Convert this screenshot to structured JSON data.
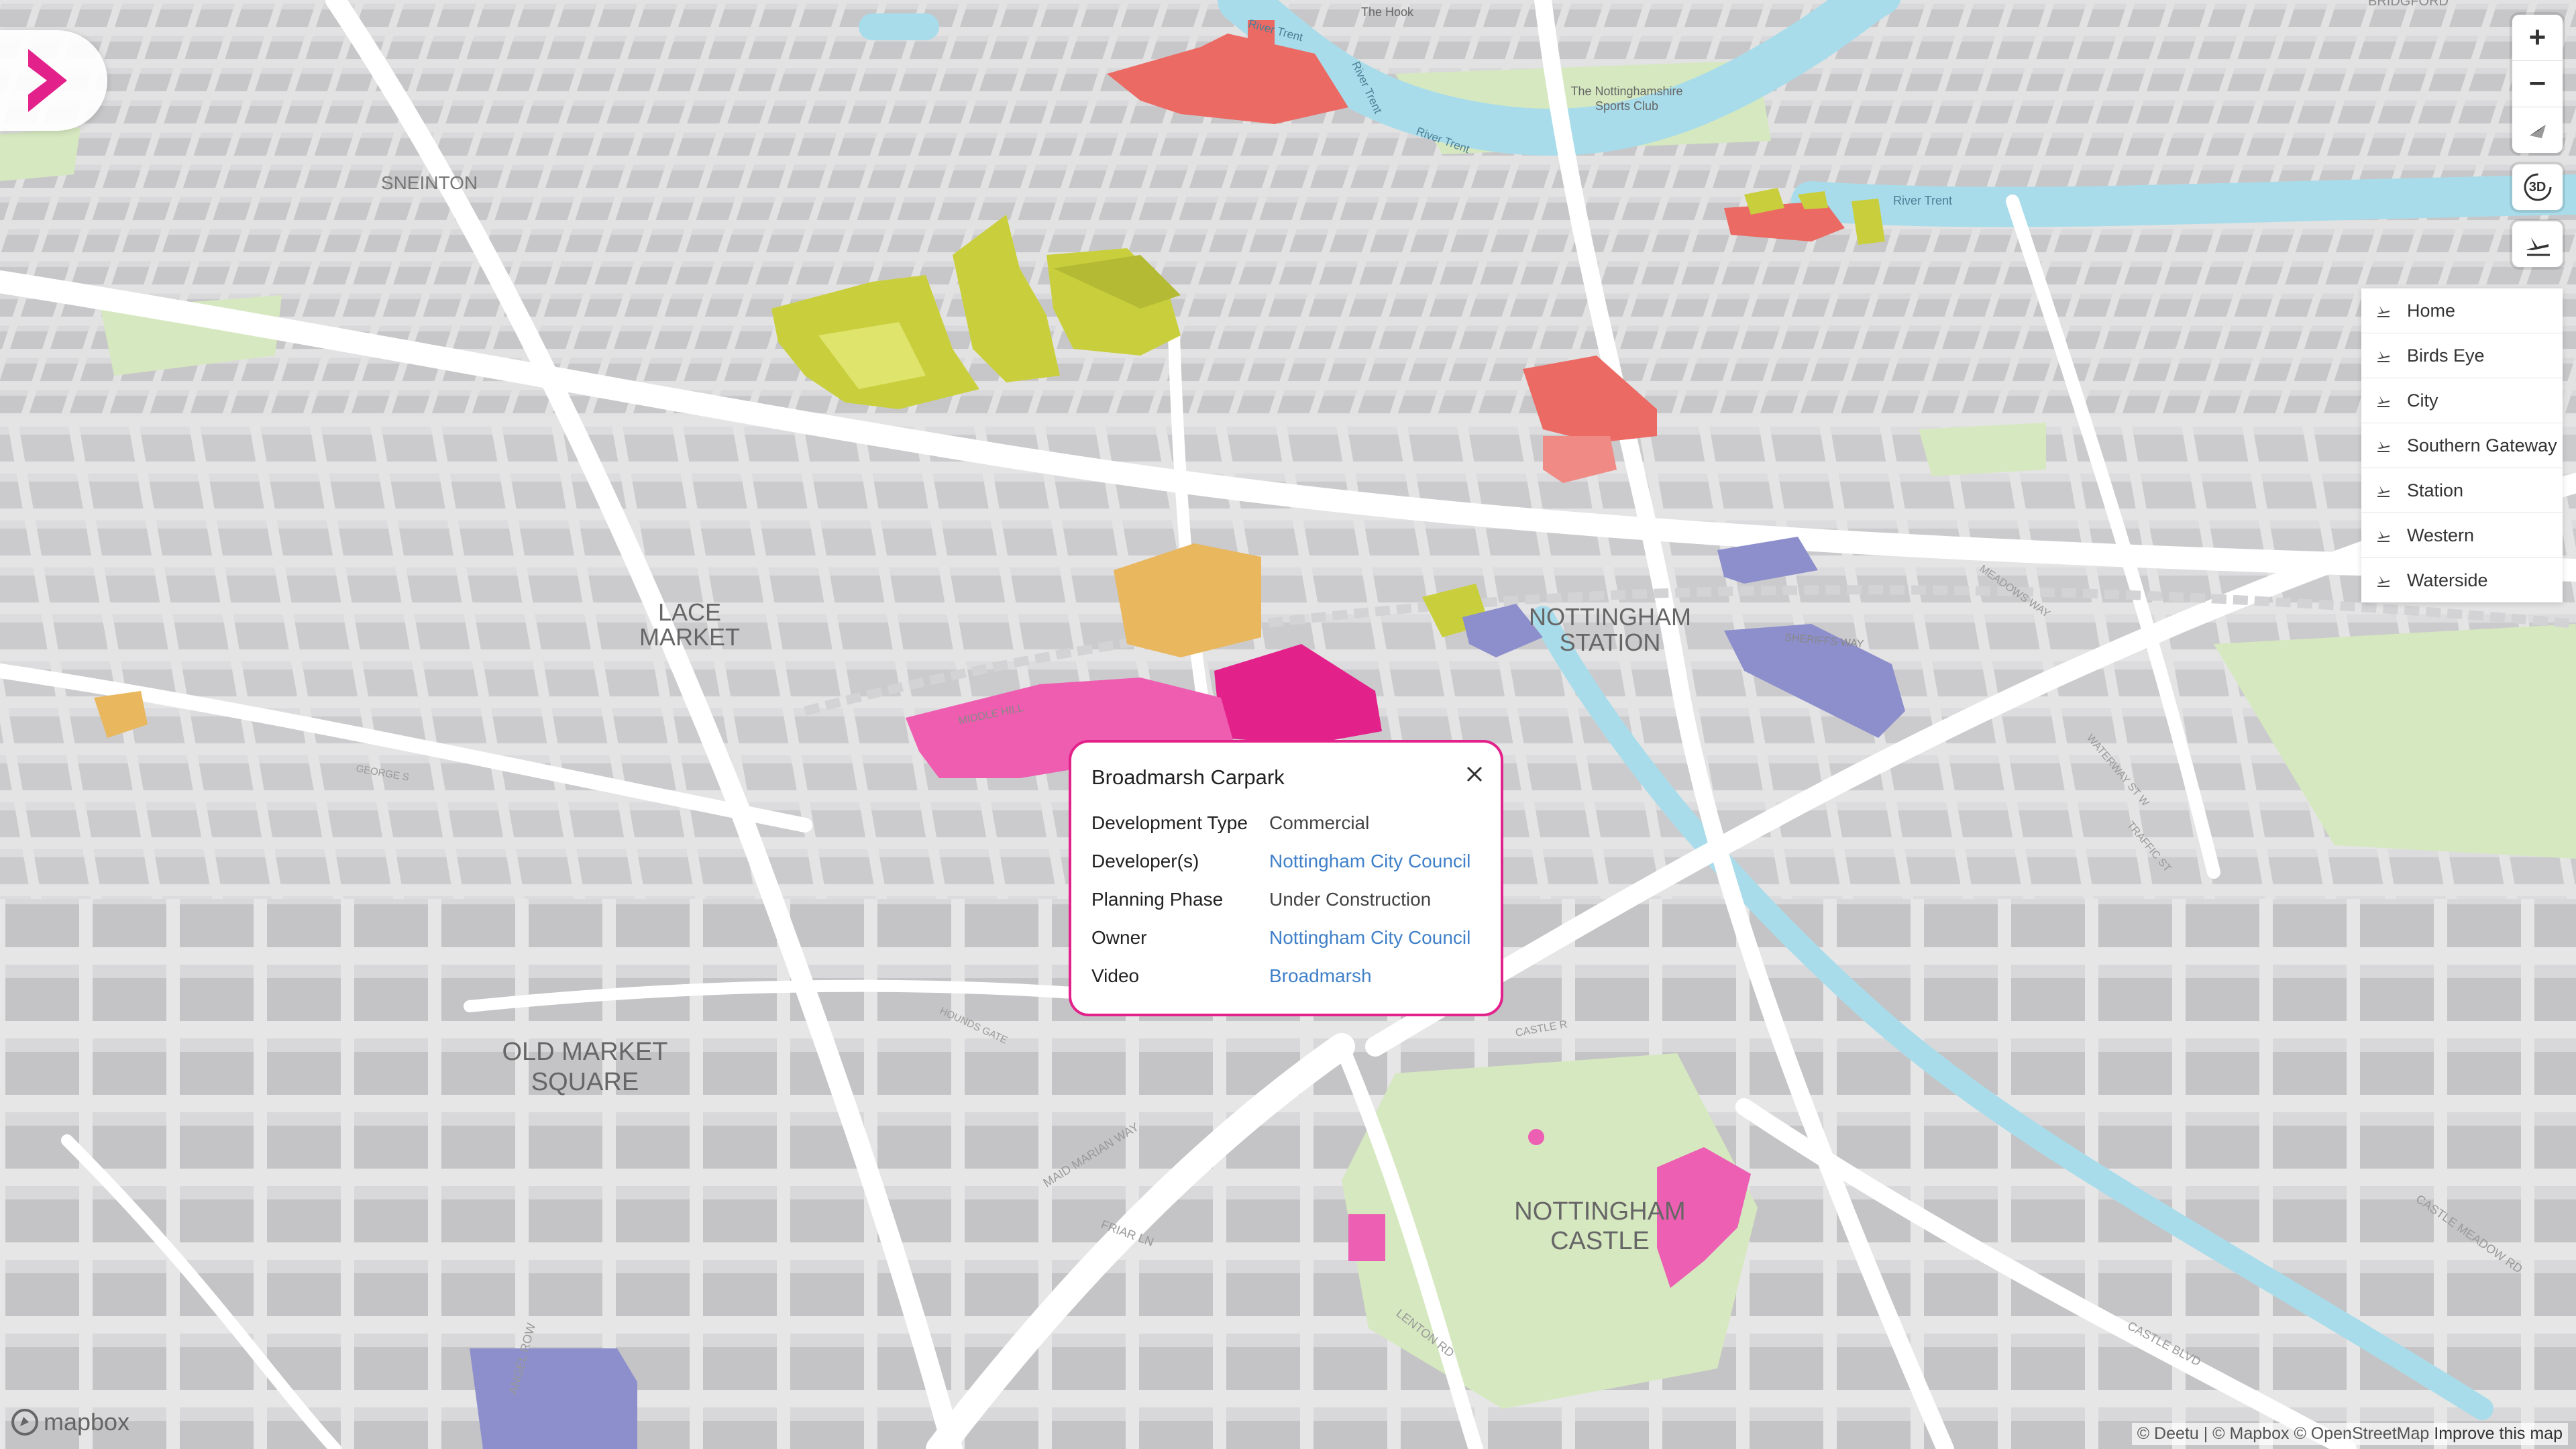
{
  "map": {
    "district_labels": [
      "SNEINTON",
      "LACE",
      "MARKET",
      "NOTTINGHAM",
      "STATION",
      "OLD MARKET",
      "SQUARE",
      "NOTTINGHAM",
      "CASTLE"
    ],
    "place_labels": [
      "The Hook",
      "The Nottinghamshire",
      "Sports Club",
      "River Trent",
      "River Trent",
      "River Trent",
      "River Trent",
      "BRIDGFORD"
    ],
    "street_labels": [
      "MIDDLE HILL",
      "SHERIFFS WAY",
      "MAID MARIAN WAY",
      "FRIAR LN",
      "LENTON RD",
      "CASTLE BLVD",
      "CASTLE MEADOW RD",
      "WATERWAY ST W",
      "TRAFFIC ST",
      "MEADOWS WAY",
      "CASTLE R",
      "ANGEL ROW",
      "HOUNDS GATE",
      "GEORGE S"
    ],
    "colors": {
      "land": "#e8e8e9",
      "buildings": "#c9c9cb",
      "roads": "#ffffff",
      "water": "#a9dcea",
      "parks": "#d6e8c0",
      "commercial": "#e3218a",
      "residential_yellow": "#c9cf3c",
      "orange": "#e9b75e",
      "red": "#eb6a63",
      "blue": "#8d8fcc"
    }
  },
  "side_toggle": {
    "icon": "chevron-right-icon",
    "color": "#e3218a"
  },
  "controls": {
    "zoom_in": "+",
    "zoom_out": "−",
    "toggle_3d": "3D"
  },
  "view_menu": {
    "items": [
      {
        "label": "Home"
      },
      {
        "label": "Birds Eye"
      },
      {
        "label": "City"
      },
      {
        "label": "Southern Gateway"
      },
      {
        "label": "Station"
      },
      {
        "label": "Western"
      },
      {
        "label": "Waterside"
      }
    ]
  },
  "popup": {
    "title": "Broadmarsh Carpark",
    "rows": [
      {
        "key": "Development Type",
        "value": "Commercial",
        "link": false
      },
      {
        "key": "Developer(s)",
        "value": "Nottingham City Council",
        "link": true
      },
      {
        "key": "Planning Phase",
        "value": "Under Construction",
        "link": false
      },
      {
        "key": "Owner",
        "value": "Nottingham City Council",
        "link": true
      },
      {
        "key": "Video",
        "value": "Broadmarsh",
        "link": true
      }
    ]
  },
  "attribution": {
    "deetu": "© Deetu",
    "separator": "|",
    "mapbox": "© Mapbox",
    "osm": "© OpenStreetMap",
    "improve": "Improve this map"
  },
  "mapbox_logo": "mapbox"
}
